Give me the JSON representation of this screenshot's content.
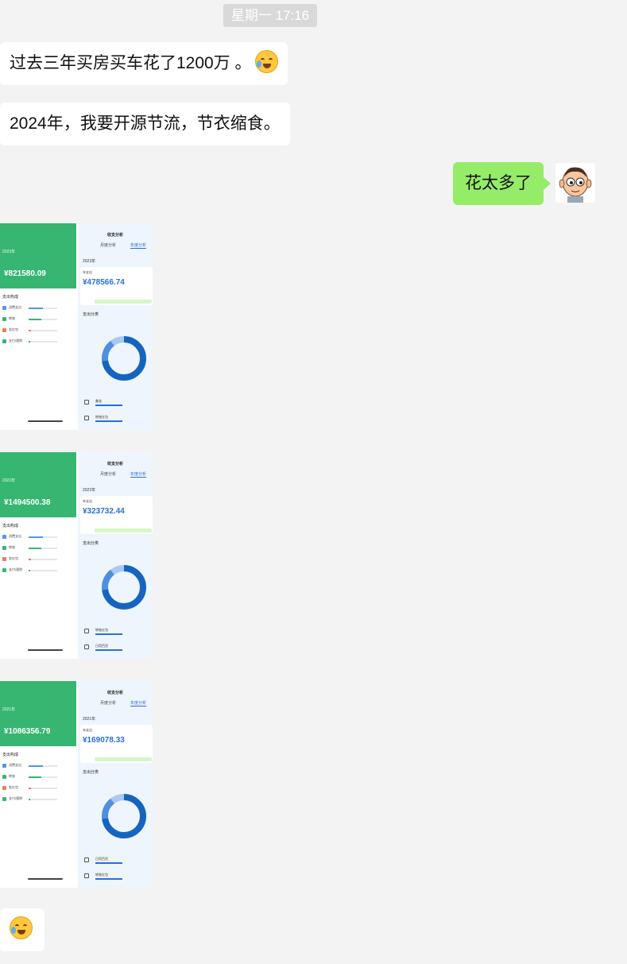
{
  "timestamp": "星期一 17:16",
  "messages": [
    {
      "side": "left",
      "text": "过去三年买房买车花了1200万 。",
      "emoji": "crying-face-icon"
    },
    {
      "side": "left",
      "text": "2024年，我要开源节流，节衣缩食。"
    },
    {
      "side": "right",
      "text": "花太多了"
    }
  ],
  "screenshots": [
    {
      "left_year": "2023年",
      "left_amount": "¥821580.09",
      "right_title": "收支分析",
      "tab_month": "月度分析",
      "tab_year": "年度分析",
      "right_year": "2023年",
      "card_label": "年支出",
      "right_amount": "¥478566.74",
      "section": "支出分类",
      "left_section": "支出构成",
      "rows": [
        "消费支出",
        "转账",
        "发红包",
        "支付/理财"
      ],
      "items": [
        "美妆",
        "转账红包"
      ]
    },
    {
      "left_year": "2022年",
      "left_amount": "¥1494500.38",
      "right_title": "收支分析",
      "tab_month": "月度分析",
      "tab_year": "年度分析",
      "right_year": "2022年",
      "card_label": "年支出",
      "right_amount": "¥323732.44",
      "section": "支出分类",
      "left_section": "支出构成",
      "rows": [
        "消费支出",
        "转账",
        "发红包",
        "支付/理财"
      ],
      "items": [
        "转账红包",
        "日用百货"
      ]
    },
    {
      "left_year": "2021年",
      "left_amount": "¥1086356.79",
      "right_title": "收支分析",
      "tab_month": "月度分析",
      "tab_year": "年度分析",
      "right_year": "2021年",
      "card_label": "年支出",
      "right_amount": "¥169078.33",
      "section": "支出分类",
      "left_section": "支出构成",
      "rows": [
        "消费支出",
        "转账",
        "发红包",
        "支付/理财"
      ],
      "items": [
        "日用百货",
        "转账红包"
      ]
    }
  ],
  "last_message_emoji": "crying-face-icon",
  "colors": {
    "green_bubble": "#95ec69",
    "wechat_green": "#36b671",
    "accent_blue": "#2a6fdb"
  }
}
